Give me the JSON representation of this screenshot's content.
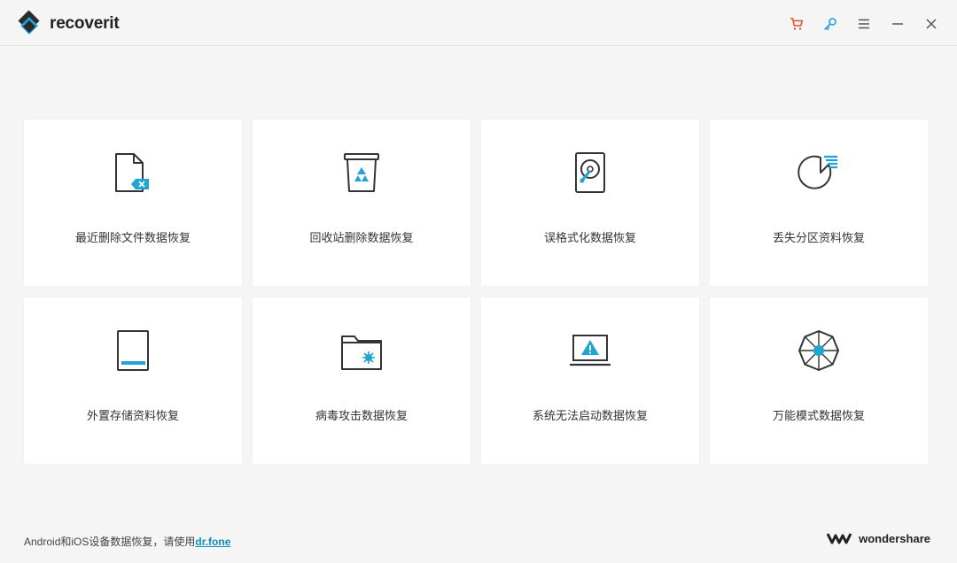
{
  "app": {
    "name": "recoverit"
  },
  "colors": {
    "accent": "#1ea5d6",
    "cart": "#e8502a",
    "icon": "#333333"
  },
  "window_controls": [
    {
      "name": "cart-icon"
    },
    {
      "name": "key-icon"
    },
    {
      "name": "menu-icon"
    },
    {
      "name": "minimize-icon"
    },
    {
      "name": "close-icon"
    }
  ],
  "cards": [
    {
      "label": "最近删除文件数据恢复",
      "icon": "deleted-file-icon"
    },
    {
      "label": "回收站删除数据恢复",
      "icon": "recycle-bin-icon"
    },
    {
      "label": "误格式化数据恢复",
      "icon": "hard-drive-icon"
    },
    {
      "label": "丢失分区资料恢复",
      "icon": "lost-partition-icon"
    },
    {
      "label": "外置存储资料恢复",
      "icon": "external-storage-icon"
    },
    {
      "label": "病毒攻击数据恢复",
      "icon": "virus-folder-icon"
    },
    {
      "label": "系统无法启动数据恢复",
      "icon": "crashed-computer-icon"
    },
    {
      "label": "万能模式数据恢复",
      "icon": "all-around-icon"
    }
  ],
  "footer": {
    "text": "Android和iOS设备数据恢复，请使用",
    "link": "dr.fone",
    "brand": "wondershare"
  }
}
